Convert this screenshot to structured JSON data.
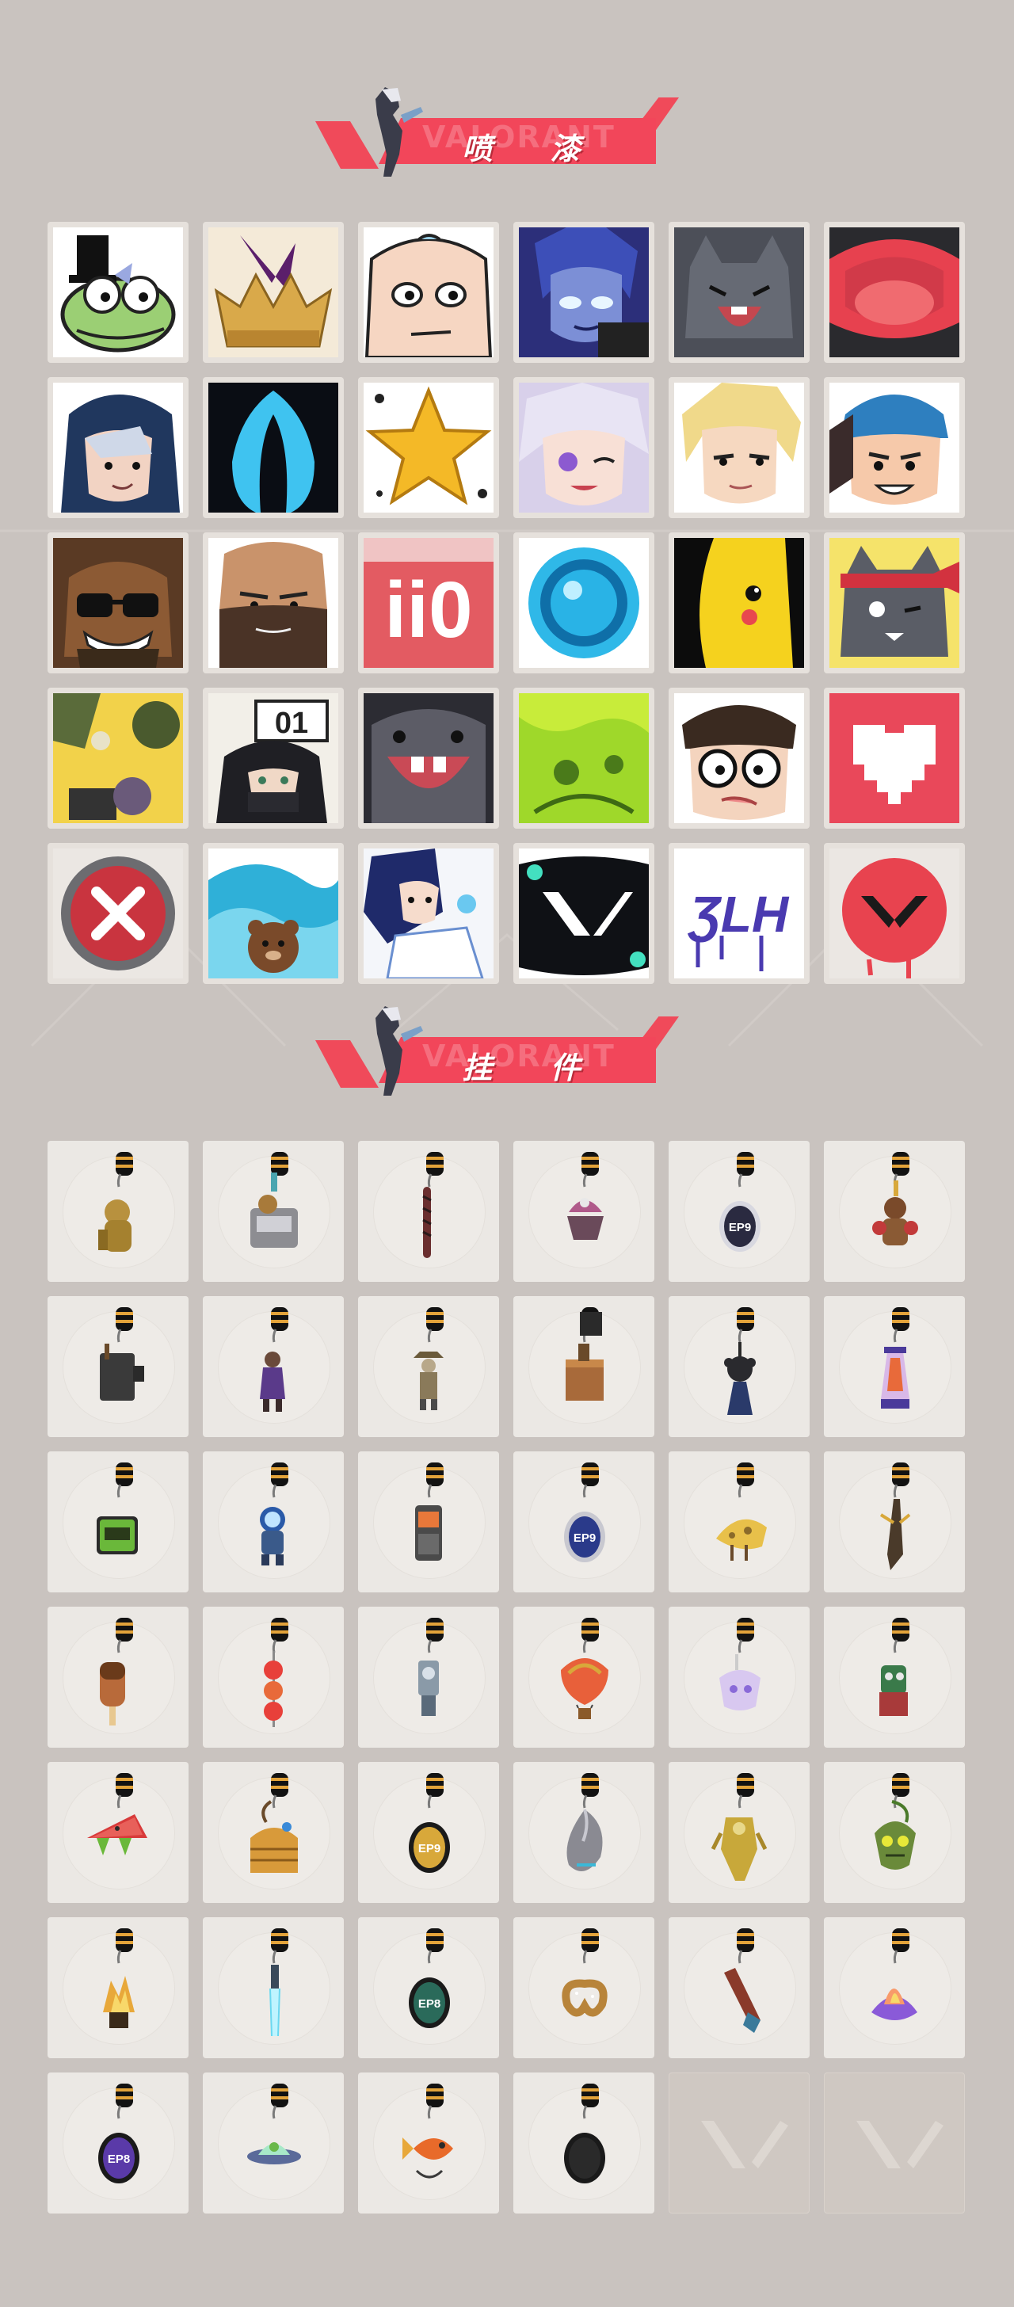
{
  "sections": {
    "sprays": {
      "title": "喷 漆",
      "watermark": "VALORANT"
    },
    "buddies": {
      "title": "挂 件",
      "watermark": "VALORANT"
    }
  },
  "colors": {
    "background": "#c9c3bf",
    "tile": "#ebe7e3",
    "accent": "#f2465a",
    "empty_tile": "#cfc8c2"
  },
  "sprays": [
    {
      "name": "frog-wizard-spray-icon"
    },
    {
      "name": "gold-crown-spray-icon"
    },
    {
      "name": "bald-face-spray-icon"
    },
    {
      "name": "blue-hair-agent-spray-icon"
    },
    {
      "name": "grey-cat-laughing-spray-icon"
    },
    {
      "name": "red-mouth-spray-icon"
    },
    {
      "name": "hooded-agent-spray-icon"
    },
    {
      "name": "blue-tentacle-spray-icon"
    },
    {
      "name": "gold-star-spray-icon"
    },
    {
      "name": "white-hair-wink-spray-icon"
    },
    {
      "name": "blonde-agent-spray-icon"
    },
    {
      "name": "beanie-agent-spray-icon"
    },
    {
      "name": "sunglasses-agent-spray-icon"
    },
    {
      "name": "bearded-agent-spray-icon"
    },
    {
      "name": "ii0-spray-icon"
    },
    {
      "name": "blue-orb-spray-icon"
    },
    {
      "name": "yellow-creature-spray-icon"
    },
    {
      "name": "headband-cat-spray-icon"
    },
    {
      "name": "grenade-spray-icon"
    },
    {
      "name": "masked-agent-01-spray-icon"
    },
    {
      "name": "grey-monster-spray-icon"
    },
    {
      "name": "green-slime-spray-icon"
    },
    {
      "name": "glasses-agent-spray-icon"
    },
    {
      "name": "pixel-heart-spray-icon"
    },
    {
      "name": "red-x-button-spray-icon"
    },
    {
      "name": "wave-bear-spray-icon"
    },
    {
      "name": "anime-agent-spray-icon"
    },
    {
      "name": "valorant-logo-spray-icon"
    },
    {
      "name": "graffiti-tag-spray-icon"
    },
    {
      "name": "red-valorant-drip-spray-icon"
    }
  ],
  "buddies": [
    {
      "name": "gold-bear-buddy-icon"
    },
    {
      "name": "slot-machine-buddy-icon"
    },
    {
      "name": "braided-cord-buddy-icon"
    },
    {
      "name": "cupcake-buddy-icon"
    },
    {
      "name": "ep9-medal-buddy-icon",
      "label": "EP9"
    },
    {
      "name": "teddy-boxer-buddy-icon"
    },
    {
      "name": "radio-backpack-buddy-icon"
    },
    {
      "name": "agent-figure-buddy-icon"
    },
    {
      "name": "cowboy-figure-buddy-icon"
    },
    {
      "name": "wooden-crate-buddy-icon"
    },
    {
      "name": "camera-robot-buddy-icon"
    },
    {
      "name": "lava-lamp-buddy-icon"
    },
    {
      "name": "green-pager-buddy-icon"
    },
    {
      "name": "astronaut-buddy-icon"
    },
    {
      "name": "orange-device-buddy-icon"
    },
    {
      "name": "ep9-blue-medal-buddy-icon",
      "label": "EP9"
    },
    {
      "name": "cheese-slice-buddy-icon"
    },
    {
      "name": "dark-blade-buddy-icon"
    },
    {
      "name": "popsicle-buddy-icon"
    },
    {
      "name": "red-candy-skewer-buddy-icon"
    },
    {
      "name": "robot-mask-buddy-icon"
    },
    {
      "name": "hot-air-balloon-buddy-icon"
    },
    {
      "name": "pastel-creature-buddy-icon"
    },
    {
      "name": "green-monster-buddy-icon"
    },
    {
      "name": "watermelon-buddy-icon"
    },
    {
      "name": "beehive-buddy-icon"
    },
    {
      "name": "ep9-gold-medal-buddy-icon",
      "label": "EP9"
    },
    {
      "name": "silver-hook-buddy-icon"
    },
    {
      "name": "gold-robot-buddy-icon"
    },
    {
      "name": "green-goblin-buddy-icon"
    },
    {
      "name": "trophy-flame-buddy-icon"
    },
    {
      "name": "light-saber-buddy-icon"
    },
    {
      "name": "ep8-green-medal-buddy-icon",
      "label": "EP8"
    },
    {
      "name": "pretzel-buddy-icon"
    },
    {
      "name": "bottle-buddy-icon"
    },
    {
      "name": "purple-flame-buddy-icon"
    },
    {
      "name": "ep8-purple-medal-buddy-icon",
      "label": "EP8"
    },
    {
      "name": "ufo-buddy-icon"
    },
    {
      "name": "orange-fish-buddy-icon"
    },
    {
      "name": "valorant-medal-buddy-icon"
    },
    {
      "name": "empty-slot-icon",
      "empty": true
    },
    {
      "name": "empty-slot-icon",
      "empty": true
    }
  ]
}
